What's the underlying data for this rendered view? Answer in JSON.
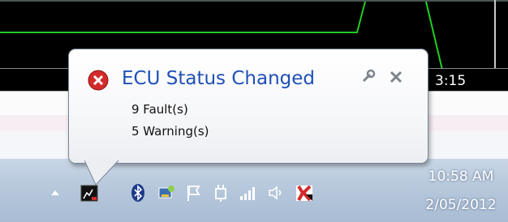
{
  "background_app": {
    "axis_tick_label": "3:15"
  },
  "notification": {
    "title": "ECU Status Changed",
    "lines": [
      "9 Fault(s)",
      "5 Warning(s)"
    ],
    "icon": "error-icon",
    "options_icon": "wrench-icon",
    "close_icon": "close-icon"
  },
  "tray": {
    "icons": [
      "show-hidden-icons-arrow-icon",
      "ecu-app-tray-icon",
      "bluetooth-icon",
      "network-sharing-icon",
      "action-center-flag-icon",
      "power-plug-icon",
      "signal-bars-icon",
      "volume-icon",
      "antivirus-icon"
    ]
  },
  "clock": {
    "time": "10:58 AM",
    "date": "2/05/2012"
  },
  "colors": {
    "title": "#1f4fb7",
    "chart_line": "#22cc22",
    "taskbar": "#b7c8dc",
    "error_red": "#d42a2a"
  }
}
